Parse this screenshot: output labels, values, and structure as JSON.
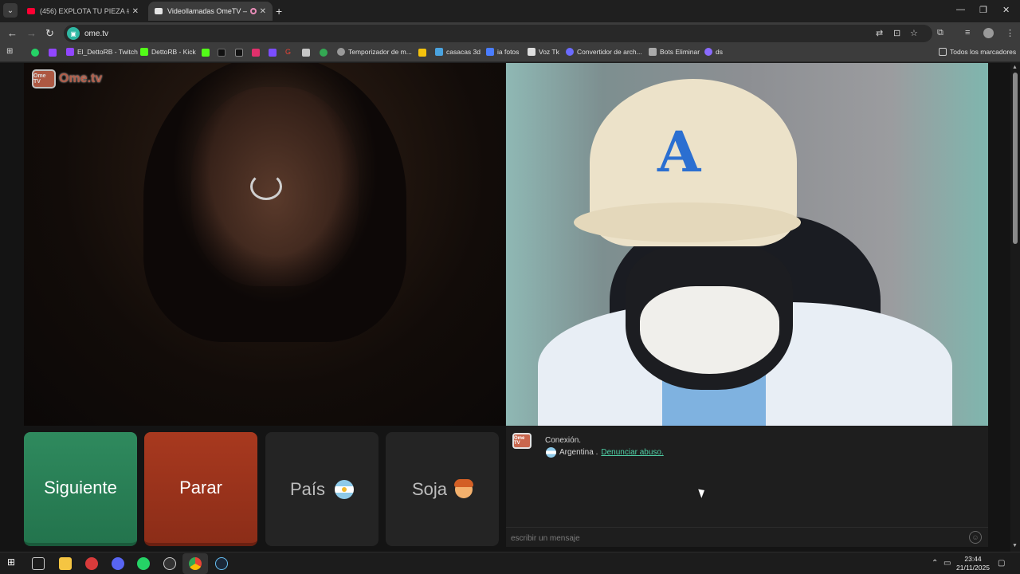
{
  "browser": {
    "tabs": [
      {
        "title": "(456) EXPLOTA TU PIEZA #1 EL...",
        "favicon_color": "#ff0033",
        "active": false
      },
      {
        "title": "Videollamadas OmeTV — A",
        "favicon_color": "#e5e5e5",
        "active": true
      }
    ],
    "new_tab_symbol": "+",
    "address": "ome.tv",
    "bookmarks": [
      {
        "label": "El_DettoRB - Twitch",
        "icon_color": "#9146ff"
      },
      {
        "label": "DettoRB - Kick",
        "icon_color": "#53fc18"
      },
      {
        "label": "Temporizador de m...",
        "icon_color": "#999999"
      },
      {
        "label": "casacas 3d",
        "icon_color": "#4aa3df"
      },
      {
        "label": "ia fotos",
        "icon_color": "#4a7dff"
      },
      {
        "label": "Voz Tk",
        "icon_color": "#dddddd"
      },
      {
        "label": "Convertidor de arch...",
        "icon_color": "#6b6bff"
      },
      {
        "label": "Bots Eliminar",
        "icon_color": "#aaaaaa"
      },
      {
        "label": "ds",
        "icon_color": "#8a6bff"
      }
    ],
    "all_bookmarks": "Todos los marcadores"
  },
  "app": {
    "logo_text": "Ome.tv",
    "logo_badge": "Ome TV",
    "buttons": {
      "next": "Siguiente",
      "stop": "Parar",
      "country": "País",
      "gender": "Soja"
    },
    "chat": {
      "status": "Conexión.",
      "country": "Argentina .",
      "report_link": "Denunciar abuso.",
      "input_placeholder": "escribir un mensaje"
    },
    "colors": {
      "next": "#2f8a5e",
      "stop": "#a8391f",
      "link": "#4fd0a6"
    }
  },
  "taskbar": {
    "time": "23:44",
    "date": "21/11/2025"
  }
}
